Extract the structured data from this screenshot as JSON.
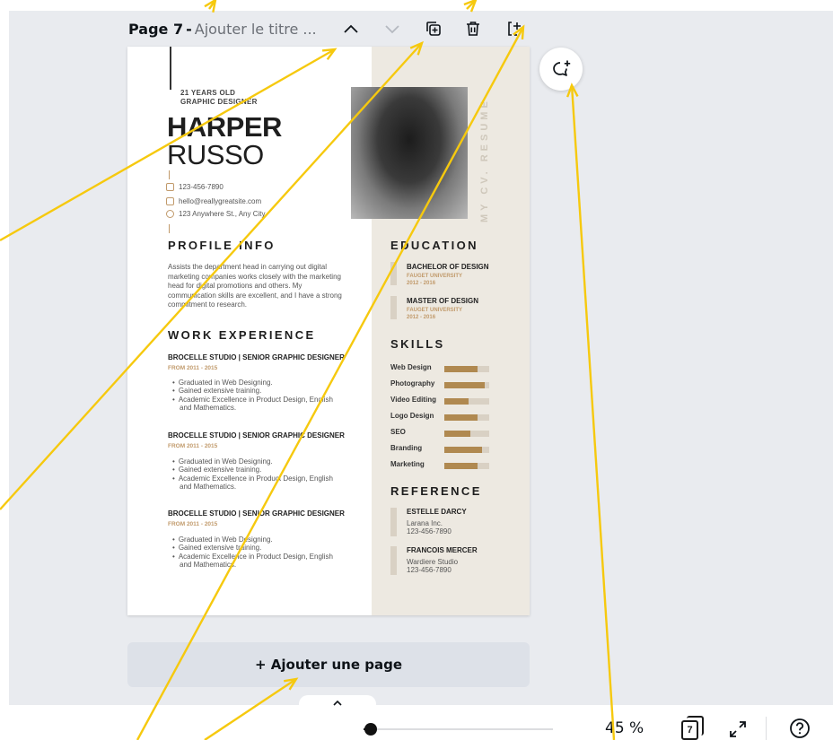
{
  "header": {
    "page_number": "Page 7",
    "separator": "-",
    "title_placeholder": "Ajouter le titre ..."
  },
  "icons": [
    "chevron-up-icon",
    "chevron-down-icon",
    "duplicate-page-icon",
    "delete-icon",
    "add-page-icon",
    "add-comment-icon",
    "grid-view-icon",
    "fullscreen-icon",
    "help-icon",
    "collapse-chevron-icon"
  ],
  "resume": {
    "age_line": "21 YEARS OLD",
    "role_line": "GRAPHIC DESIGNER",
    "first_name": "HARPER",
    "last_name": "RUSSO",
    "phone": "123-456-7890",
    "email": "hello@reallygreatsite.com",
    "address": "123 Anywhere St., Any City",
    "side_label": "MY CV. RESUME",
    "profile": {
      "title": "PROFILE INFO",
      "lines": [
        "Assists the department head in carrying out digital",
        "marketing companies works closely with the marketing",
        "head for digital promotions and others. My",
        "communication skills are excellent, and I have a strong",
        "commitment to research."
      ]
    },
    "work": {
      "title": "WORK EXPERIENCE",
      "jobs": [
        {
          "title": "BROCELLE STUDIO  |  SENIOR GRAPHIC DESIGNER",
          "date": "FROM 2011 - 2015",
          "b1": "Graduated in Web Designing.",
          "b2": "Gained extensive training.",
          "b3": "Academic Excellence in Product Design, English",
          "b3b": "and Mathematics."
        },
        {
          "title": "BROCELLE STUDIO  |  SENIOR GRAPHIC DESIGNER",
          "date": "FROM 2011 - 2015",
          "b1": "Graduated in Web Designing.",
          "b2": "Gained extensive training.",
          "b3": "Academic Excellence in Product Design, English",
          "b3b": "and Mathematics."
        },
        {
          "title": "BROCELLE STUDIO  |  SENIOR GRAPHIC DESIGNER",
          "date": "FROM 2011 - 2015",
          "b1": "Graduated in Web Designing.",
          "b2": "Gained extensive training.",
          "b3": "Academic Excellence in Product Design, English",
          "b3b": "and Mathematics."
        }
      ]
    },
    "education": {
      "title": "EDUCATION",
      "items": [
        {
          "degree": "BACHELOR OF DESIGN",
          "school": "FAUGET UNIVERSITY",
          "years": "2012 - 2016"
        },
        {
          "degree": "MASTER OF DESIGN",
          "school": "FAUGET UNIVERSITY",
          "years": "2012 - 2016"
        }
      ]
    },
    "skills": {
      "title": "SKILLS",
      "items": [
        {
          "name": "Web Design",
          "level": 0.74
        },
        {
          "name": "Photography",
          "level": 0.9
        },
        {
          "name": "Video Editing",
          "level": 0.54
        },
        {
          "name": "Logo Design",
          "level": 0.74
        },
        {
          "name": "SEO",
          "level": 0.58
        },
        {
          "name": "Branding",
          "level": 0.84
        },
        {
          "name": "Marketing",
          "level": 0.74
        }
      ]
    },
    "reference": {
      "title": "REFERENCE",
      "items": [
        {
          "name": "ESTELLE DARCY",
          "company": "Larana Inc.",
          "phone": "123-456-7890"
        },
        {
          "name": "FRANCOIS MERCER",
          "company": "Wardiere Studio",
          "phone": "123-456-7890"
        }
      ]
    }
  },
  "add_page_label": "+ Ajouter une page",
  "footer": {
    "zoom": "45 %",
    "zoom_level": 0.04,
    "page_count": "7"
  },
  "colors": {
    "accent": "#c19a6b",
    "annotation": "#f6c90e",
    "canvas_bg": "#e9ebef",
    "skill_fill": "#b08950"
  }
}
